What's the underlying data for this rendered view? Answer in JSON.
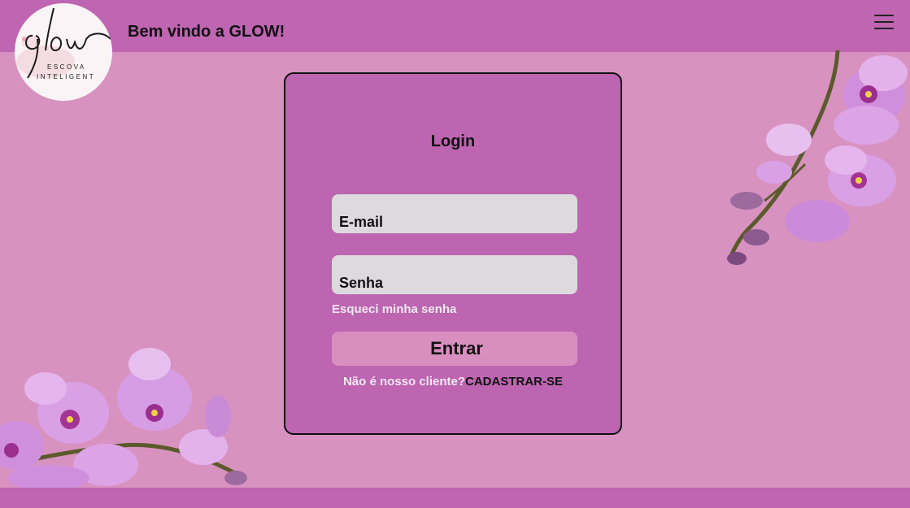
{
  "header": {
    "welcome": "Bem vindo a GLOW!"
  },
  "logo": {
    "brand": "glow",
    "line1": "ESCOVA",
    "line2": "INTELIGENT"
  },
  "login": {
    "title": "Login",
    "email_placeholder": "E-mail",
    "password_placeholder": "Senha",
    "forgot_label": "Esqueci minha senha",
    "submit_label": "Entrar",
    "signup_question": "Não é nosso cliente?",
    "signup_link": "CADASTRAR-SE"
  },
  "icons": {
    "menu": "hamburger-menu-icon",
    "decor": "orchid-flowers"
  },
  "colors": {
    "background": "#d892c0",
    "bar": "#bf65b2",
    "card": "#bd65b1",
    "input": "#dcdadd",
    "button": "#d98ec0"
  }
}
